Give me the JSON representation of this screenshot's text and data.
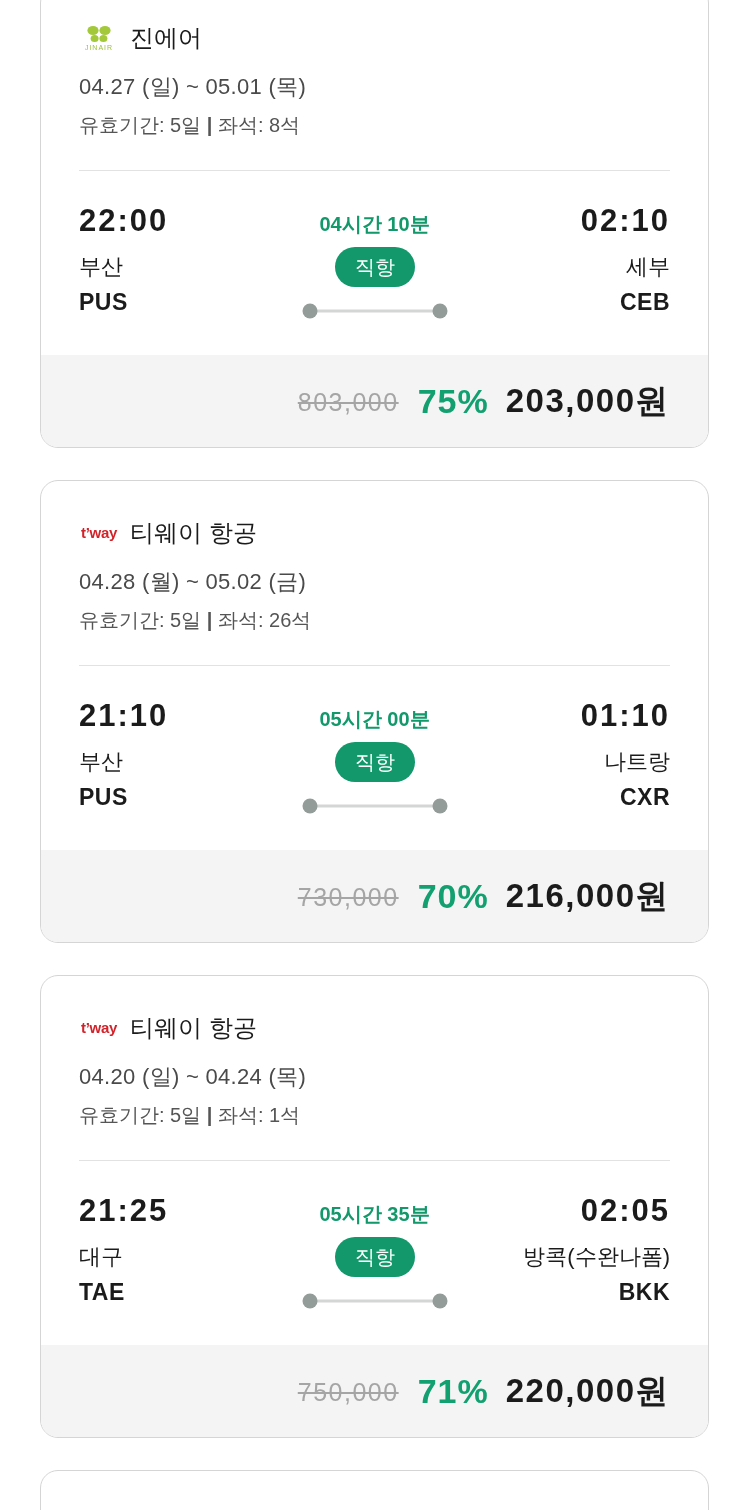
{
  "flights": [
    {
      "airline": {
        "logo": {
          "kind": "jinair",
          "text": "JINAIR"
        },
        "name": "진에어"
      },
      "dates": "04.27 (일) ~ 05.01 (목)",
      "info": "유효기간: 5일 **|** 좌석: 8석",
      "departure": {
        "time": "22:00",
        "city": "부산",
        "code": "PUS"
      },
      "duration": "04시간 10분",
      "badge": "직항",
      "arrival": {
        "time": "02:10",
        "city": "세부",
        "code": "CEB"
      },
      "price": {
        "original": "803,000",
        "discount": "75%",
        "sale": "203,000원"
      }
    },
    {
      "airline": {
        "logo": {
          "kind": "tway",
          "text": "t’way"
        },
        "name": "티웨이 항공"
      },
      "dates": "04.28 (월) ~ 05.02 (금)",
      "info": "유효기간: 5일 **|** 좌석: 26석",
      "departure": {
        "time": "21:10",
        "city": "부산",
        "code": "PUS"
      },
      "duration": "05시간 00분",
      "badge": "직항",
      "arrival": {
        "time": "01:10",
        "city": "나트랑",
        "code": "CXR"
      },
      "price": {
        "original": "730,000",
        "discount": "70%",
        "sale": "216,000원"
      }
    },
    {
      "airline": {
        "logo": {
          "kind": "tway",
          "text": "t’way"
        },
        "name": "티웨이 항공"
      },
      "dates": "04.20 (일) ~ 04.24 (목)",
      "info": "유효기간: 5일 **|** 좌석: 1석",
      "departure": {
        "time": "21:25",
        "city": "대구",
        "code": "TAE"
      },
      "duration": "05시간 35분",
      "badge": "직항",
      "arrival": {
        "time": "02:05",
        "city": "방콕(수완나폼)",
        "code": "BKK"
      },
      "price": {
        "original": "750,000",
        "discount": "71%",
        "sale": "220,000원"
      }
    }
  ],
  "next_card_peek": true
}
